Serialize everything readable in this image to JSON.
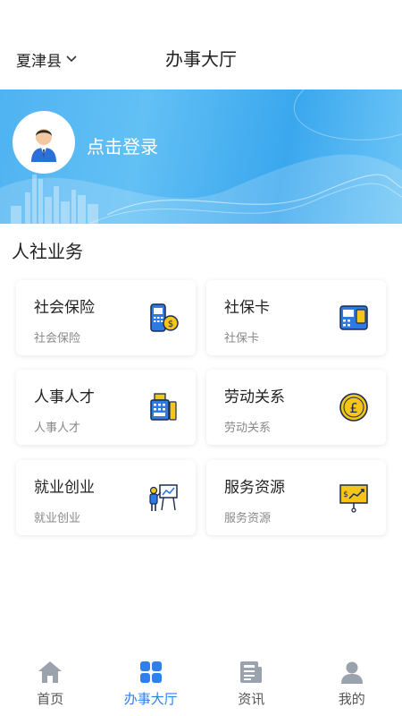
{
  "header": {
    "region": "夏津县",
    "title": "办事大厅"
  },
  "banner": {
    "login_text": "点击登录"
  },
  "section": {
    "title": "人社业务"
  },
  "services": [
    {
      "title": "社会保险",
      "subtitle": "社会保险",
      "icon": "pos-terminal-coin-icon"
    },
    {
      "title": "社保卡",
      "subtitle": "社保卡",
      "icon": "card-terminal-icon"
    },
    {
      "title": "人事人才",
      "subtitle": "人事人才",
      "icon": "cash-register-icon"
    },
    {
      "title": "劳动关系",
      "subtitle": "劳动关系",
      "icon": "pound-coin-icon"
    },
    {
      "title": "就业创业",
      "subtitle": "就业创业",
      "icon": "presenter-board-icon"
    },
    {
      "title": "服务资源",
      "subtitle": "服务资源",
      "icon": "growth-chart-board-icon"
    }
  ],
  "tabbar": {
    "items": [
      {
        "label": "首页",
        "icon": "home-icon",
        "active": false
      },
      {
        "label": "办事大厅",
        "icon": "grid-icon",
        "active": true
      },
      {
        "label": "资讯",
        "icon": "news-icon",
        "active": false
      },
      {
        "label": "我的",
        "icon": "user-icon",
        "active": false
      }
    ]
  },
  "colors": {
    "accent": "#2f80ed",
    "banner": "#4fb3f2",
    "icon_blue": "#2c7be5",
    "icon_yellow": "#f5c518"
  }
}
